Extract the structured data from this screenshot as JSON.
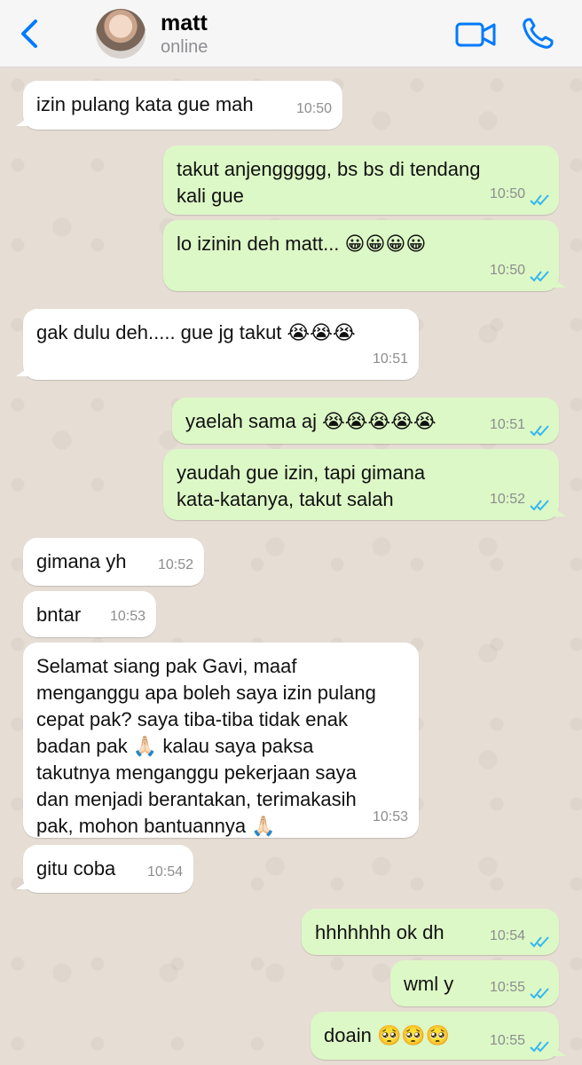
{
  "header": {
    "contact_name": "matt",
    "contact_status": "online",
    "accent_color": "#007aff",
    "icons": [
      "chevron-left-icon",
      "avatar",
      "video-camera-icon",
      "phone-icon"
    ]
  },
  "messages": [
    {
      "dir": "in",
      "text": "izin pulang kata gue mah",
      "time": "10:50"
    },
    {
      "dir": "out",
      "text": "takut anjenggggg, bs bs di tendang\nkali gue",
      "time": "10:50"
    },
    {
      "dir": "out",
      "text": "lo izinin deh matt... 😀😀😀😀",
      "time": "10:50"
    },
    {
      "dir": "in",
      "text": "gak dulu deh..... gue jg takut 😭😭😭",
      "time": "10:51"
    },
    {
      "dir": "out",
      "text": "yaelah sama aj 😭😭😭😭😭",
      "time": "10:51"
    },
    {
      "dir": "out",
      "text": "yaudah gue izin, tapi gimana\nkata-katanya, takut salah",
      "time": "10:52"
    },
    {
      "dir": "in",
      "text": "gimana yh",
      "time": "10:52"
    },
    {
      "dir": "in",
      "text": "bntar",
      "time": "10:53"
    },
    {
      "dir": "in",
      "text": "Selamat siang pak Gavi, maaf\nmenganggu apa boleh saya izin pulang\ncepat pak? saya tiba-tiba tidak enak\nbadan pak 🙏🏻 kalau saya paksa\ntakutnya menganggu pekerjaan saya\ndan menjadi berantakan, terimakasih\npak, mohon bantuannya 🙏🏻",
      "time": "10:53"
    },
    {
      "dir": "in",
      "text": "gitu coba",
      "time": "10:54"
    },
    {
      "dir": "out",
      "text": "hhhhhhh ok dh",
      "time": "10:54"
    },
    {
      "dir": "out",
      "text": "wml y",
      "time": "10:55"
    },
    {
      "dir": "out",
      "text": "doain 🥺🥺🥺",
      "time": "10:55"
    }
  ],
  "colors": {
    "incoming_bubble": "#ffffff",
    "outgoing_bubble": "#dcf8c6",
    "read_ticks": "#34b7f1",
    "chat_background": "#e6ddd4"
  }
}
